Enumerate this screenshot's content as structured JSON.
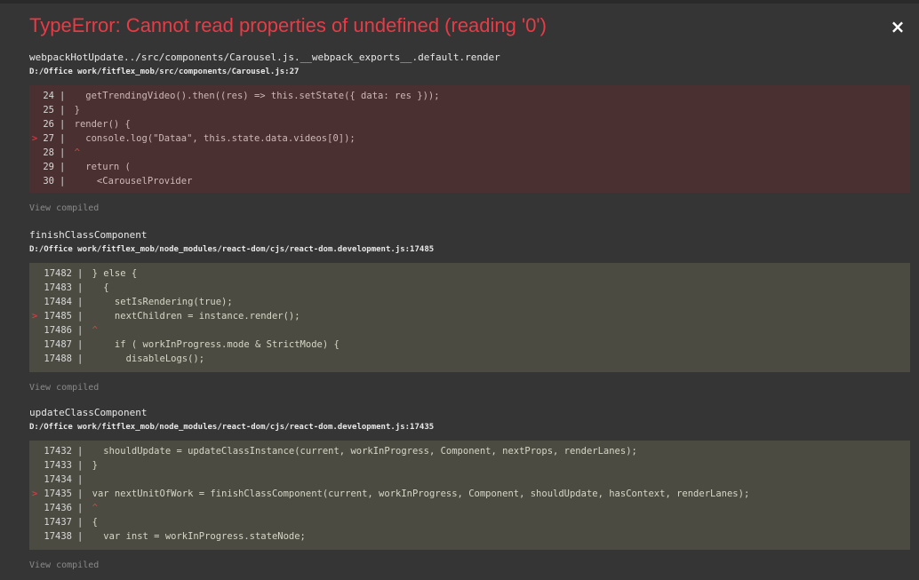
{
  "error": {
    "title": "TypeError: Cannot read properties of undefined (reading '0')",
    "close_symbol": "×"
  },
  "frames": [
    {
      "function": "webpackHotUpdate../src/components/Carousel.js.__webpack_exports__.default.render",
      "location": "D:/Office work/fitflex_mob/src/components/Carousel.js:27",
      "style": "red",
      "lines": [
        {
          "num": "24",
          "text": "   getTrendingVideo().then((res) => this.setState({ data: res }));",
          "active": false
        },
        {
          "num": "25",
          "text": " }",
          "active": false
        },
        {
          "num": "26",
          "text": " render() {",
          "active": false
        },
        {
          "num": "27",
          "text": "   console.log(\"Dataa\", this.state.data.videos[0]);",
          "active": true
        },
        {
          "num": "28",
          "text": " ^",
          "active": false
        },
        {
          "num": "29",
          "text": "   return (",
          "active": false
        },
        {
          "num": "30",
          "text": "     <CarouselProvider",
          "active": false
        }
      ],
      "view_compiled": "View compiled"
    },
    {
      "function": "finishClassComponent",
      "location": "D:/Office work/fitflex_mob/node_modules/react-dom/cjs/react-dom.development.js:17485",
      "style": "grey",
      "lines": [
        {
          "num": "17482",
          "text": " } else {",
          "active": false
        },
        {
          "num": "17483",
          "text": "   {",
          "active": false
        },
        {
          "num": "17484",
          "text": "     setIsRendering(true);",
          "active": false
        },
        {
          "num": "17485",
          "text": "     nextChildren = instance.render();",
          "active": true
        },
        {
          "num": "17486",
          "text": " ^",
          "active": false
        },
        {
          "num": "17487",
          "text": "     if ( workInProgress.mode & StrictMode) {",
          "active": false
        },
        {
          "num": "17488",
          "text": "       disableLogs();",
          "active": false
        }
      ],
      "view_compiled": "View compiled"
    },
    {
      "function": "updateClassComponent",
      "location": "D:/Office work/fitflex_mob/node_modules/react-dom/cjs/react-dom.development.js:17435",
      "style": "grey",
      "lines": [
        {
          "num": "17432",
          "text": "   shouldUpdate = updateClassInstance(current, workInProgress, Component, nextProps, renderLanes);",
          "active": false
        },
        {
          "num": "17433",
          "text": " }",
          "active": false
        },
        {
          "num": "17434",
          "text": "",
          "active": false
        },
        {
          "num": "17435",
          "text": " var nextUnitOfWork = finishClassComponent(current, workInProgress, Component, shouldUpdate, hasContext, renderLanes);",
          "active": true
        },
        {
          "num": "17436",
          "text": " ^",
          "active": false
        },
        {
          "num": "17437",
          "text": " {",
          "active": false
        },
        {
          "num": "17438",
          "text": "   var inst = workInProgress.stateNode;",
          "active": false
        }
      ],
      "view_compiled": "View compiled"
    }
  ],
  "colors": {
    "background": "#353535",
    "error_red": "#e83b46",
    "code_bg_red": "#4a3030",
    "code_bg_grey": "#4b4b41"
  }
}
